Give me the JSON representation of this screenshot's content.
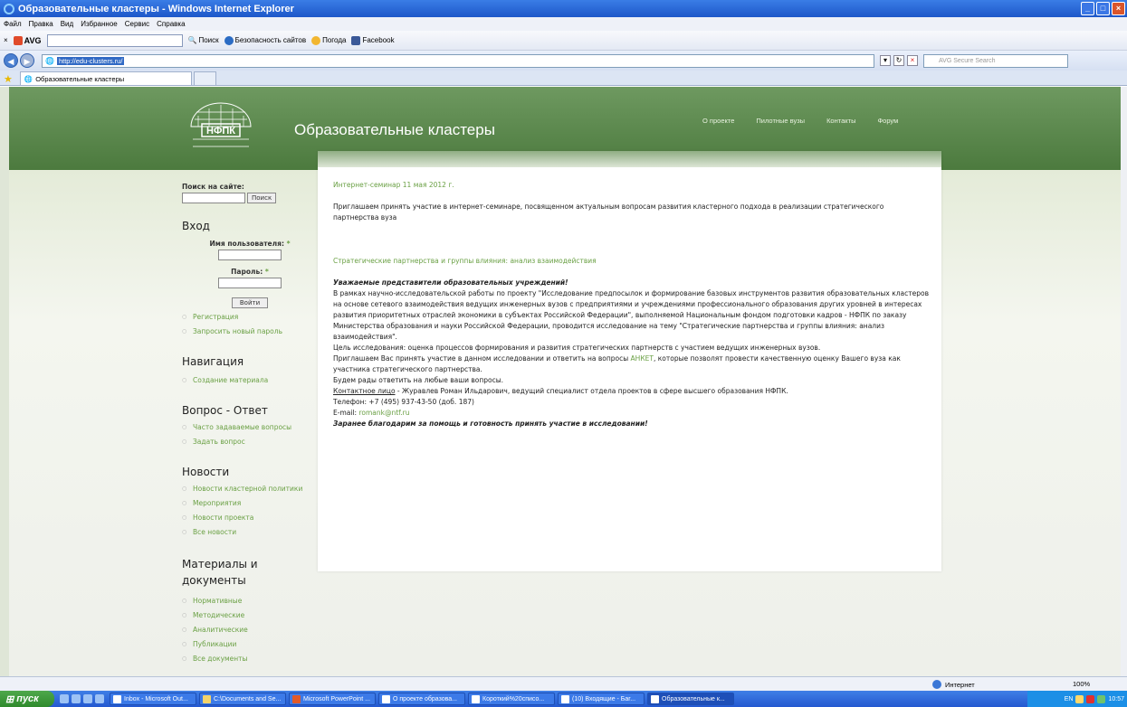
{
  "window": {
    "title": "Образовательные кластеры - Windows Internet Explorer",
    "min": "_",
    "max": "□",
    "close": "×"
  },
  "menubar": [
    "Файл",
    "Правка",
    "Вид",
    "Избранное",
    "Сервис",
    "Справка"
  ],
  "toolbar": {
    "close_x": "×",
    "avg": "AVG",
    "search": "Поиск",
    "security": "Безопасность сайтов",
    "weather": "Погода",
    "facebook": "Facebook"
  },
  "address": {
    "url": "http://edu-clusters.ru/",
    "search_placeholder": "AVG Secure Search"
  },
  "tab": {
    "label": "Образовательные кластеры"
  },
  "site": {
    "title": "Образовательные кластеры",
    "logo_text": "НФПК",
    "nav": [
      "О проекте",
      "Пилотные вузы",
      "Контакты",
      "Форум"
    ]
  },
  "sidebar": {
    "search_label": "Поиск на сайте:",
    "search_button": "Поиск",
    "login_heading": "Вход",
    "username_label": "Имя пользователя:",
    "password_label": "Пароль:",
    "required_mark": "*",
    "login_button": "Войти",
    "login_links": [
      "Регистрация",
      "Запросить новый пароль"
    ],
    "nav_heading": "Навигация",
    "nav_links": [
      "Создание материала"
    ],
    "faq_heading": "Вопрос - Ответ",
    "faq_links": [
      "Часто задаваемые вопросы",
      "Задать вопрос"
    ],
    "news_heading": "Новости",
    "news_links": [
      "Новости кластерной политики",
      "Мероприятия",
      "Новости проекта",
      "Все новости"
    ],
    "materials_heading": "Материалы и документы",
    "materials_links": [
      "Нормативные",
      "Методические",
      "Аналитические",
      "Публикации",
      "Все документы"
    ]
  },
  "content": {
    "headline": "Интернет-семинар 11 мая 2012 г.",
    "lead": "Приглашаем принять участие в интернет-семинаре, посвященном  актуальным вопросам развития кластерного подхода в реализации стратегического партнерства вуза",
    "sublink": "Стратегические партнерства и группы влияния: анализ взаимодействия",
    "greeting": "Уважаемые представители образовательных учреждений!",
    "body1": "В рамках научно-исследовательской работы по проекту \"Исследование предпосылок и формирование базовых инструментов развития образовательных кластеров на основе сетевого взаимодействия ведущих инженерных вузов с предприятиями и учреждениями профессионального образования других уровней в интересах развития приоритетных отраслей экономики в субъектах Российской Федерации\", выполняемой Национальным фондом подготовки кадров - НФПК по заказу Министерства образования и науки Российской Федерации, проводится исследование на тему \"Стратегические партнерства и группы влияния: анализ взаимодействия\".",
    "goal": "Цель исследования: оценка процессов формирования и развития стратегических партнерств с участием ведущих инженерных вузов.",
    "invite_pre": "Приглашаем Вас принять участие в данном исследовании и ответить на вопросы ",
    "invite_link": "АНКЕТ",
    "invite_post": ", которые позволят провести качественную оценку Вашего вуза как участника стратегического партнерства.",
    "glad": "Будем рады ответить на любые ваши вопросы.",
    "contact_label": "Контактное лицо",
    "contact_text": " - Журавлев Роман Ильдарович, ведущий специалист отдела проектов в сфере высшего образования НФПК.",
    "phone": "Телефон: +7 (495) 937-43-50 (доб. 187)",
    "email_label": "E-mail: ",
    "email": "romank@ntf.ru",
    "thanks": "Заранее благодарим за помощь и готовность принять участие в исследовании!"
  },
  "status": {
    "zone": "Интернет",
    "zoom": "100%"
  },
  "taskbar": {
    "start": "пуск",
    "tasks": [
      "Inbox - Microsoft Out...",
      "C:\\Documents and Se...",
      "Microsoft PowerPoint ...",
      "О проекте образова...",
      "Короткий%20списо...",
      "(10) Входящие - Бar...",
      "Образовательные к..."
    ],
    "lang": "EN",
    "clock": "10:57"
  }
}
